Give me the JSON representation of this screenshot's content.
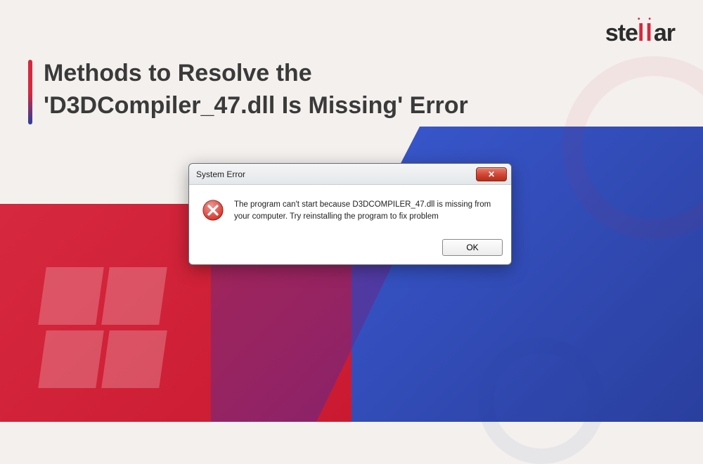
{
  "logo": {
    "left": "ste",
    "mid": "ll",
    "right": "ar"
  },
  "title": {
    "line1": "Methods to Resolve the",
    "line2": "'D3DCompiler_47.dll Is Missing' Error"
  },
  "dialog": {
    "title": "System Error",
    "close_label": "✕",
    "message": "The program can't start because D3DCOMPILER_47.dll is missing from your computer. Try reinstalling the program to fix problem",
    "ok_label": "OK"
  }
}
